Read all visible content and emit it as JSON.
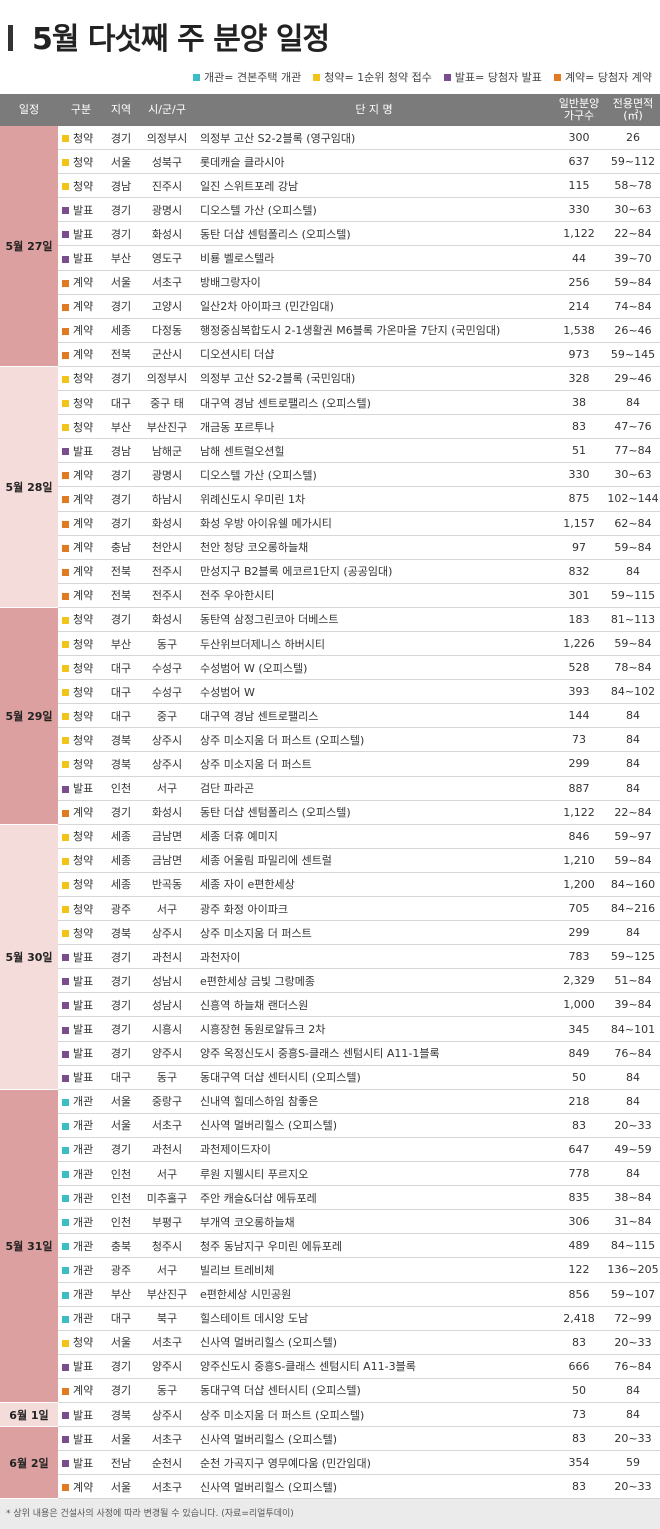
{
  "title": "5월  다섯째 주 분양 일정",
  "legend": [
    {
      "label": "개관= 견본주택 개관",
      "color": "#3cbcc4"
    },
    {
      "label": "청약= 1순위 청약 접수",
      "color": "#f2c318"
    },
    {
      "label": "발표= 당첨자 발표",
      "color": "#7a4e8e"
    },
    {
      "label": "계약= 당첨자 계약",
      "color": "#e27a22"
    }
  ],
  "type_colors": {
    "개관": "#3cbcc4",
    "청약": "#f2c318",
    "발표": "#7a4e8e",
    "계약": "#e27a22"
  },
  "header": {
    "date": "일정",
    "type": "구분",
    "region": "지역",
    "city": "시/군/구",
    "complex": "단 지 명",
    "units": [
      "일반분양",
      "가구수"
    ],
    "area": [
      "전용면적",
      "(㎡)"
    ]
  },
  "groups": [
    {
      "date": "5월 27일",
      "shade": "dark",
      "rows": [
        [
          "청약",
          "경기",
          "의정부시",
          "의정부 고산 S2-2블록 (영구임대)",
          "300",
          "26"
        ],
        [
          "청약",
          "서울",
          "성북구",
          "롯데캐슬 클라시아",
          "637",
          "59~112"
        ],
        [
          "청약",
          "경남",
          "진주시",
          "일진 스위트포레 강남",
          "115",
          "58~78"
        ],
        [
          "발표",
          "경기",
          "광명시",
          "디오스텔 가산 (오피스텔)",
          "330",
          "30~63"
        ],
        [
          "발표",
          "경기",
          "화성시",
          "동탄 더샵 센텀폴리스 (오피스텔)",
          "1,122",
          "22~84"
        ],
        [
          "발표",
          "부산",
          "영도구",
          "비룡 벨로스텔라",
          "44",
          "39~70"
        ],
        [
          "계약",
          "서울",
          "서초구",
          "방배그랑자이",
          "256",
          "59~84"
        ],
        [
          "계약",
          "경기",
          "고양시",
          "일산2차 아이파크 (민간임대)",
          "214",
          "74~84"
        ],
        [
          "계약",
          "세종",
          "다정동",
          "행정중심복합도시 2-1생활권 M6블록 가온마을 7단지 (국민임대)",
          "1,538",
          "26~46"
        ],
        [
          "계약",
          "전북",
          "군산시",
          "디오션시티 더샵",
          "973",
          "59~145"
        ]
      ]
    },
    {
      "date": "5월 28일",
      "shade": "light",
      "rows": [
        [
          "청약",
          "경기",
          "의정부시",
          "의정부 고산 S2-2블록 (국민임대)",
          "328",
          "29~46"
        ],
        [
          "청약",
          "대구",
          "중구 태",
          "대구역 경남 센트로팰리스 (오피스텔)",
          "38",
          "84"
        ],
        [
          "청약",
          "부산",
          "부산진구",
          "개금동 포르투나",
          "83",
          "47~76"
        ],
        [
          "발표",
          "경남",
          "남해군",
          "남해 센트럴오션힐",
          "51",
          "77~84"
        ],
        [
          "계약",
          "경기",
          "광명시",
          "디오스텔 가산 (오피스텔)",
          "330",
          "30~63"
        ],
        [
          "계약",
          "경기",
          "하남시",
          "위례신도시 우미린 1차",
          "875",
          "102~144"
        ],
        [
          "계약",
          "경기",
          "화성시",
          "화성 우방 아이유쉘 메가시티",
          "1,157",
          "62~84"
        ],
        [
          "계약",
          "충남",
          "천안시",
          "천안 청당 코오롱하늘채",
          "97",
          "59~84"
        ],
        [
          "계약",
          "전북",
          "전주시",
          "만성지구 B2블록 에코르1단지 (공공임대)",
          "832",
          "84"
        ],
        [
          "계약",
          "전북",
          "전주시",
          "전주 우아한시티",
          "301",
          "59~115"
        ]
      ]
    },
    {
      "date": "5월 29일",
      "shade": "dark",
      "rows": [
        [
          "청약",
          "경기",
          "화성시",
          "동탄역 삼정그린코아 더베스트",
          "183",
          "81~113"
        ],
        [
          "청약",
          "부산",
          "동구",
          "두산위브더제니스 하버시티",
          "1,226",
          "59~84"
        ],
        [
          "청약",
          "대구",
          "수성구",
          "수성범어 W (오피스텔)",
          "528",
          "78~84"
        ],
        [
          "청약",
          "대구",
          "수성구",
          "수성범어 W",
          "393",
          "84~102"
        ],
        [
          "청약",
          "대구",
          "중구",
          "대구역 경남 센트로팰리스",
          "144",
          "84"
        ],
        [
          "청약",
          "경북",
          "상주시",
          "상주 미소지움 더 퍼스트 (오피스텔)",
          "73",
          "84"
        ],
        [
          "청약",
          "경북",
          "상주시",
          "상주 미소지움 더 퍼스트",
          "299",
          "84"
        ],
        [
          "발표",
          "인천",
          "서구",
          "검단 파라곤",
          "887",
          "84"
        ],
        [
          "계약",
          "경기",
          "화성시",
          "동탄 더샵 센텀폴리스 (오피스텔)",
          "1,122",
          "22~84"
        ]
      ]
    },
    {
      "date": "5월 30일",
      "shade": "light",
      "rows": [
        [
          "청약",
          "세종",
          "금남면",
          "세종 더휴 예미지",
          "846",
          "59~97"
        ],
        [
          "청약",
          "세종",
          "금남면",
          "세종 어울림 파밀리에 센트럴",
          "1,210",
          "59~84"
        ],
        [
          "청약",
          "세종",
          "반곡동",
          "세종 자이 e편한세상",
          "1,200",
          "84~160"
        ],
        [
          "청약",
          "광주",
          "서구",
          "광주 화정 아이파크",
          "705",
          "84~216"
        ],
        [
          "청약",
          "경북",
          "상주시",
          "상주 미소지움 더 퍼스트",
          "299",
          "84"
        ],
        [
          "발표",
          "경기",
          "과천시",
          "과천자이",
          "783",
          "59~125"
        ],
        [
          "발표",
          "경기",
          "성남시",
          "e편한세상 금빛 그랑메종",
          "2,329",
          "51~84"
        ],
        [
          "발표",
          "경기",
          "성남시",
          "신흥역 하늘채 랜더스원",
          "1,000",
          "39~84"
        ],
        [
          "발표",
          "경기",
          "시흥시",
          "시흥장현 동원로얄듀크 2차",
          "345",
          "84~101"
        ],
        [
          "발표",
          "경기",
          "양주시",
          "양주 옥정신도시 중흥S-클래스 센텀시티 A11-1블록",
          "849",
          "76~84"
        ],
        [
          "발표",
          "대구",
          "동구",
          "동대구역 더샵 센터시티 (오피스텔)",
          "50",
          "84"
        ]
      ]
    },
    {
      "date": "5월 31일",
      "shade": "dark",
      "rows": [
        [
          "개관",
          "서울",
          "중랑구",
          "신내역 힐데스하임 참좋은",
          "218",
          "84"
        ],
        [
          "개관",
          "서울",
          "서초구",
          "신사역 멀버리힐스 (오피스텔)",
          "83",
          "20~33"
        ],
        [
          "개관",
          "경기",
          "과천시",
          "과천제이드자이",
          "647",
          "49~59"
        ],
        [
          "개관",
          "인천",
          "서구",
          "루원 지웰시티 푸르지오",
          "778",
          "84"
        ],
        [
          "개관",
          "인천",
          "미추홀구",
          "주안 캐슬&더샵 에듀포레",
          "835",
          "38~84"
        ],
        [
          "개관",
          "인천",
          "부평구",
          "부개역 코오롱하늘채",
          "306",
          "31~84"
        ],
        [
          "개관",
          "충북",
          "청주시",
          "청주 동남지구 우미린 에듀포레",
          "489",
          "84~115"
        ],
        [
          "개관",
          "광주",
          "서구",
          "빌리브 트레비체",
          "122",
          "136~205"
        ],
        [
          "개관",
          "부산",
          "부산진구",
          "e편한세상 시민공원",
          "856",
          "59~107"
        ],
        [
          "개관",
          "대구",
          "북구",
          "힐스테이트 데시앙 도남",
          "2,418",
          "72~99"
        ],
        [
          "청약",
          "서울",
          "서초구",
          "신사역 멀버리힐스 (오피스텔)",
          "83",
          "20~33"
        ],
        [
          "발표",
          "경기",
          "양주시",
          "양주신도시 중흥S-클래스 센텀시티 A11-3블록",
          "666",
          "76~84"
        ],
        [
          "계약",
          "경기",
          "동구",
          "동대구역 더샵 센터시티 (오피스텔)",
          "50",
          "84"
        ]
      ]
    },
    {
      "date": "6월 1일",
      "shade": "light",
      "rows": [
        [
          "발표",
          "경북",
          "상주시",
          "상주 미소지움 더 퍼스트 (오피스텔)",
          "73",
          "84"
        ]
      ]
    },
    {
      "date": "6월 2일",
      "shade": "dark",
      "rows": [
        [
          "발표",
          "서울",
          "서초구",
          "신사역 멀버리힐스 (오피스텔)",
          "83",
          "20~33"
        ],
        [
          "발표",
          "전남",
          "순천시",
          "순천 가곡지구 영무예다움 (민간임대)",
          "354",
          "59"
        ],
        [
          "계약",
          "서울",
          "서초구",
          "신사역 멀버리힐스 (오피스텔)",
          "83",
          "20~33"
        ]
      ]
    }
  ],
  "footer": "* 상위 내용은 건설사의 사정에 따라 변경될 수 있습니다. (자료=리얼투데이)"
}
